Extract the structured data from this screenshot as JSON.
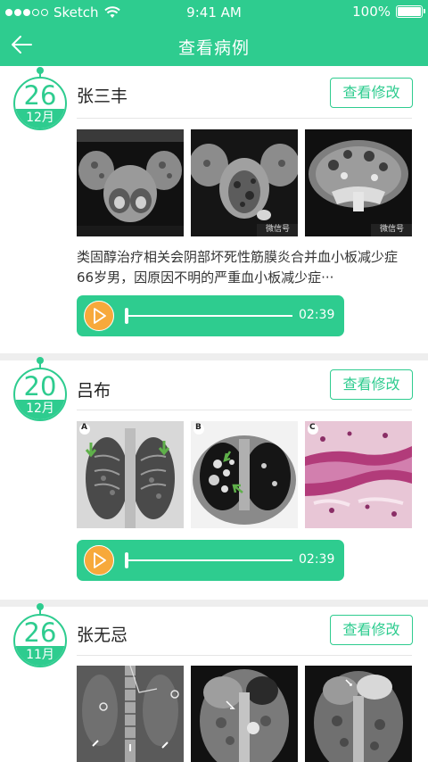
{
  "status_bar": {
    "carrier": "Sketch",
    "time": "9:41 AM",
    "battery": "100%"
  },
  "nav": {
    "title": "查看病例",
    "back_icon": "back-arrow-icon"
  },
  "cases": [
    {
      "day": "26",
      "month": "12月",
      "name": "张三丰",
      "edit_label": "查看修改",
      "description": "类固醇治疗相关会阴部坏死性筋膜炎合并血小板减少症 66岁男，因原因不明的严重血小板减少症···",
      "duration": "02:39",
      "watermark": "微信号"
    },
    {
      "day": "20",
      "month": "12月",
      "name": "吕布",
      "edit_label": "查看修改",
      "duration": "02:39",
      "panel_labels": [
        "A",
        "B",
        "C"
      ]
    },
    {
      "day": "26",
      "month": "11月",
      "name": "张无忌",
      "edit_label": "查看修改"
    }
  ],
  "colors": {
    "accent": "#2ecc8f",
    "play": "#f7a93b"
  }
}
